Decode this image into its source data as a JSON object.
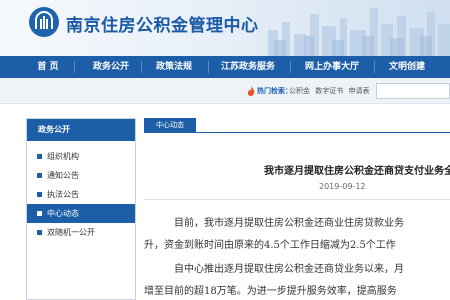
{
  "header": {
    "site_title": "南京住房公积金管理中心"
  },
  "nav": {
    "items": [
      {
        "label": "首  页"
      },
      {
        "label": "政务公开"
      },
      {
        "label": "政策法规"
      },
      {
        "label": "江苏政务服务"
      },
      {
        "label": "网上办事大厅"
      },
      {
        "label": "文明创建"
      }
    ]
  },
  "hot_search": {
    "label": "热门检索：",
    "words": [
      "公积金",
      "数字证书",
      "申请表"
    ]
  },
  "sidebar": {
    "title": "政务公开",
    "items": [
      {
        "label": "组织机构",
        "active": false
      },
      {
        "label": "通知公告",
        "active": false
      },
      {
        "label": "执法公告",
        "active": false
      },
      {
        "label": "中心动态",
        "active": true
      },
      {
        "label": "双随机一公开",
        "active": false
      }
    ]
  },
  "content": {
    "tab_label": "中心动态",
    "article_title": "我市逐月提取住房公积金还商贷支付业务全面",
    "date": "2019-09-12",
    "lines": [
      "目前，我市逐月提取住房公积金还商业住房贷款业务",
      "升，资金到账时间由原来的4.5个工作日缩减为2.5个工作",
      "自中心推出逐月提取住房公积金还商贷业务以来，月",
      "增至目前的超18万笔。为进一步提升服务效率，提高服务"
    ]
  },
  "colors": {
    "brand_blue": "#1c5ea8",
    "header_bg": "#e9f0f8"
  }
}
